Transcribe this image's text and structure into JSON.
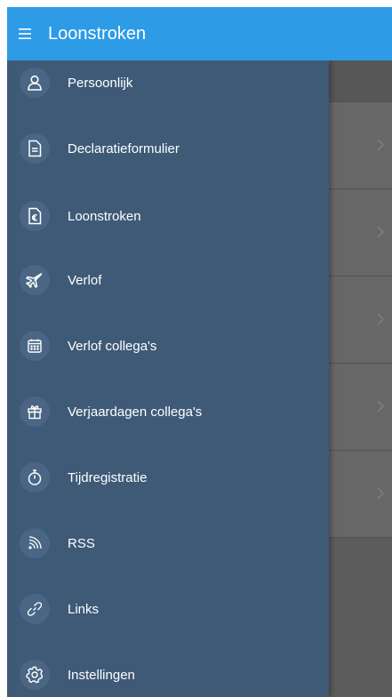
{
  "appbar": {
    "title": "Loonstroken",
    "menu_icon": "hamburger-menu-icon",
    "color": "#2d9be6"
  },
  "drawer": {
    "background": "#3e5a77",
    "items": [
      {
        "label": "Persoonlijk",
        "icon": "person-icon"
      },
      {
        "label": "Declaratieformulier",
        "icon": "document-icon"
      },
      {
        "label": "Loonstroken",
        "icon": "euro-document-icon"
      },
      {
        "label": "Verlof",
        "icon": "airplane-icon"
      },
      {
        "label": "Verlof collega's",
        "icon": "calendar-icon"
      },
      {
        "label": "Verjaardagen collega's",
        "icon": "gift-icon"
      },
      {
        "label": "Tijdregistratie",
        "icon": "stopwatch-icon"
      },
      {
        "label": "RSS",
        "icon": "rss-icon"
      },
      {
        "label": "Links",
        "icon": "link-icon"
      },
      {
        "label": "Instellingen",
        "icon": "gear-icon"
      }
    ]
  }
}
